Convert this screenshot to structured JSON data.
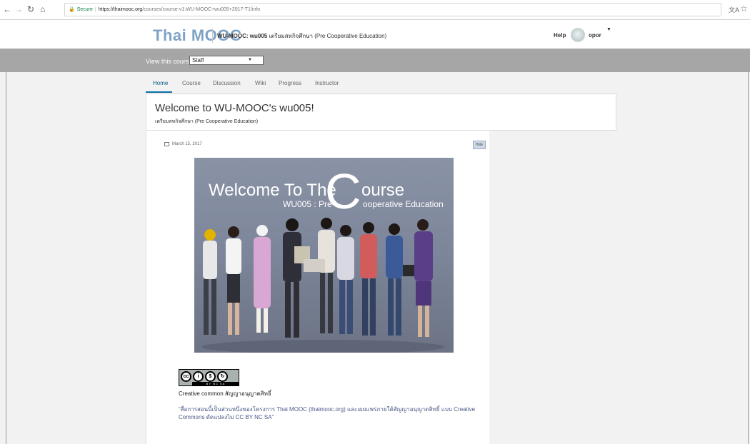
{
  "browser": {
    "secure_label": "Secure",
    "url_host": "https://thaimooc.org",
    "url_path": "/courses/course-v1:WU-MOOC+wu005+2017-T1/info"
  },
  "header": {
    "logo": "Thai MOOC",
    "course_code": "WU-MOOC: wu005",
    "course_name": "เตรียมสหกิจศึกษา (Pre Cooperative Education)",
    "help": "Help",
    "username": "opor"
  },
  "staff_bar": {
    "label": "View this course as:",
    "selected": "Staff"
  },
  "tabs": [
    {
      "label": "Home",
      "active": true
    },
    {
      "label": "Course"
    },
    {
      "label": "Discussion"
    },
    {
      "label": "Wiki"
    },
    {
      "label": "Progress"
    },
    {
      "label": "Instructor"
    }
  ],
  "welcome": {
    "title": "Welcome to WU-MOOC's wu005!",
    "subtitle": "เตรียมสหกิจศึกษา (Pre Cooperative Education)"
  },
  "update": {
    "date": "March 15, 2017",
    "hide": "Hide",
    "hero_title_1": "Welcome To The",
    "hero_c": "C",
    "hero_title_2": "ourse",
    "hero_sub_1": "WU005 : Pre",
    "hero_sub_2": "ooperative Education",
    "cc_heading": "Creative common สัญญาอนุญาตสิทธิ์",
    "cc_text": "“สื่อการสอนนี้เป็นส่วนหนึ่งของโครงการ Thai MOOC (thaimooc.org) และเผยแพร่ภายใต้สัญญาอนุญาตสิทธิ์ แบบ Creative Commons ดัดแปลงไม่ CC BY NC SA”",
    "cc_badge": [
      "cc",
      "BY",
      "NC",
      "SA"
    ]
  },
  "colors": {
    "logo": "#7fa3c5",
    "staff_bar": "#a6a6a6",
    "active_tab": "#0a5a8a"
  }
}
